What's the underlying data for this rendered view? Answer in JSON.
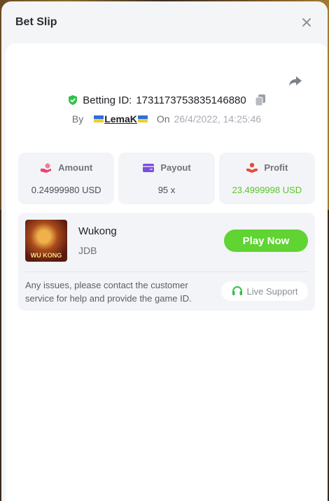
{
  "modal": {
    "title": "Bet Slip"
  },
  "bet": {
    "betting_id_label": "Betting ID:",
    "betting_id": "1731173753835146880",
    "by_label": "By",
    "username": "LemaK",
    "on_label": "On",
    "datetime": "26/4/2022, 14:25:46"
  },
  "stats": [
    {
      "label": "Amount",
      "value": "0.24999980 USD",
      "icon": "money-hand-icon",
      "color": "#e8456b"
    },
    {
      "label": "Payout",
      "value": "95 x",
      "icon": "card-icon",
      "color": "#7b4fe0"
    },
    {
      "label": "Profit",
      "value": "23.4999998 USD",
      "icon": "profit-hand-icon",
      "color": "#e84a3a"
    }
  ],
  "game": {
    "name": "Wukong",
    "provider": "JDB",
    "thumb_text": "WU KONG",
    "play_label": "Play Now"
  },
  "support": {
    "message": "Any issues, please contact the customer service for help and provide the game ID.",
    "button_label": "Live Support"
  },
  "colors": {
    "accent_green": "#5fd432",
    "profit_green": "#5ac52c",
    "verified_green": "#2fc24a"
  }
}
